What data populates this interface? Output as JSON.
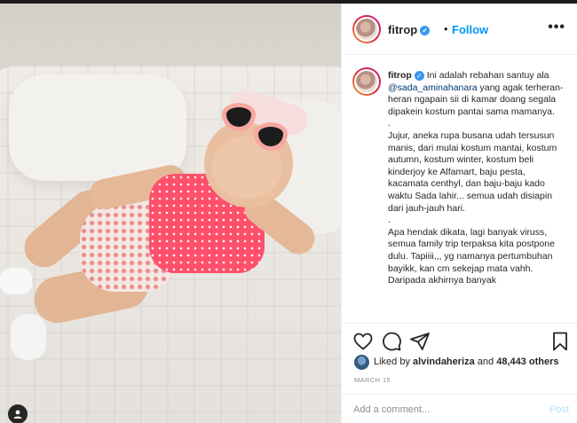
{
  "header": {
    "username": "fitrop",
    "verified_icon": "verified-badge-icon",
    "dot": "•",
    "follow_label": "Follow",
    "more_label": "•••"
  },
  "caption": {
    "username": "fitrop",
    "intro": " Ini adalah rebahan santuy ala ",
    "mention": "@sada_aminahanara",
    "intro_rest": " yang agak terheran-heran ngapain sii di kamar doang segala dipakein kostum pantai sama mamanya.",
    "sep1": ".",
    "para2": "Jujur, aneka rupa busana udah tersusun manis, dari mulai kostum mantai, kostum autumn, kostum winter, kostum beli kinderjoy ke Alfamart, baju pesta, kacamata centhyl, dan baju-baju kado waktu Sada lahir... semua udah disiapin dari jauh-jauh hari.",
    "sep2": ".",
    "para3": "Apa hendak dikata, lagi banyak viruss, semua family trip terpaksa kita postpone dulu. Tapiiii,,, yg namanya pertumbuhan bayikk, kan cm sekejap mata vahh. Daripada akhirnya banyak"
  },
  "actions": {
    "like_icon": "heart-icon",
    "comment_icon": "comment-icon",
    "share_icon": "paper-plane-icon",
    "save_icon": "bookmark-icon"
  },
  "likes": {
    "prefix": "Liked by ",
    "user": "alvindaheriza",
    "middle": " and ",
    "count": "48,443 others"
  },
  "date": "MARCH 15",
  "comment": {
    "placeholder": "Add a comment...",
    "post_label": "Post"
  },
  "colors": {
    "accent": "#0095f6",
    "post_disabled": "#b2dffc",
    "muted": "#8e8e8e",
    "text": "#262626"
  }
}
